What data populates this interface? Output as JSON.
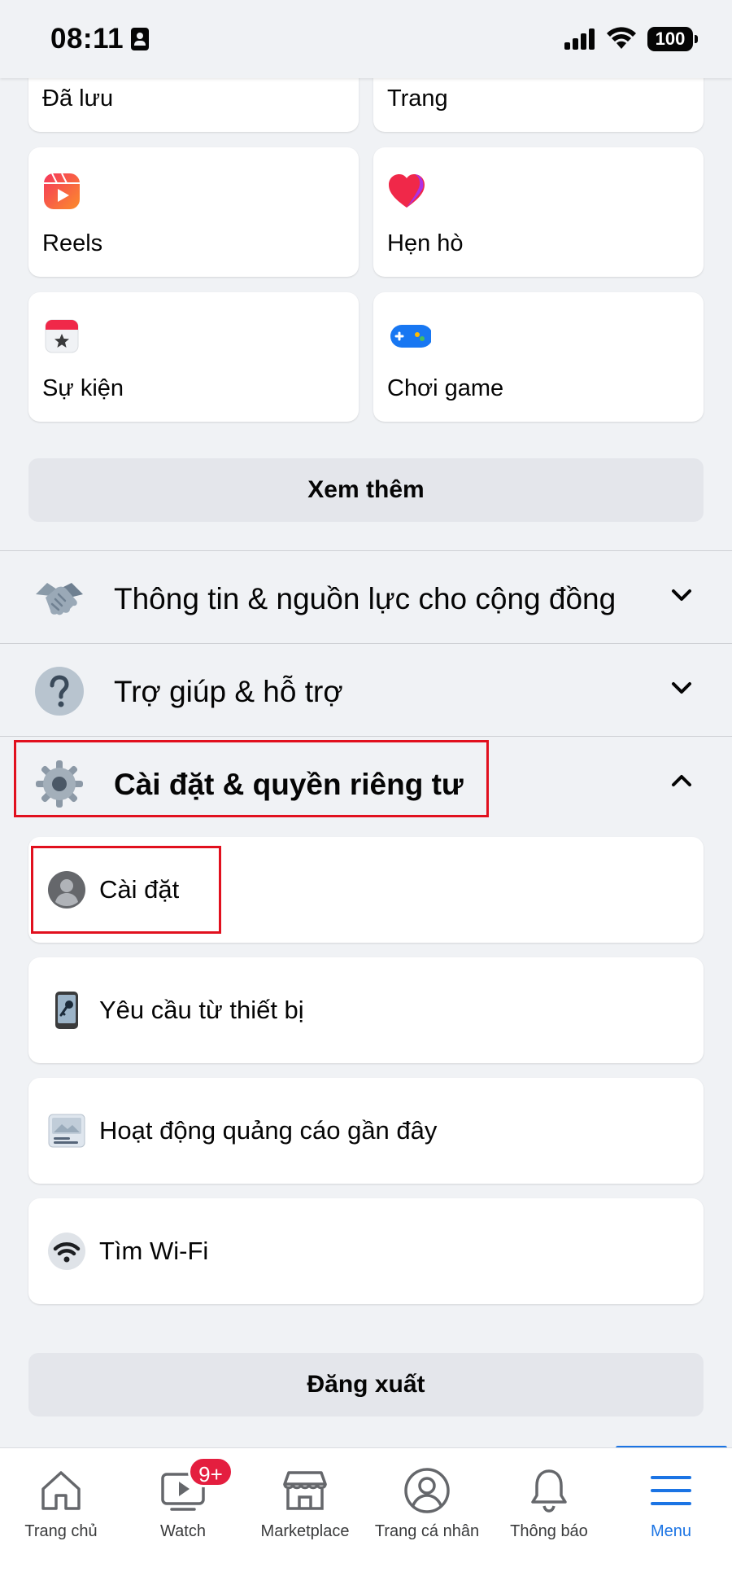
{
  "status_bar": {
    "time": "08:11",
    "battery": "100"
  },
  "shortcuts": {
    "saved": "Đã lưu",
    "pages": "Trang",
    "reels": "Reels",
    "dating": "Hẹn hò",
    "events": "Sự kiện",
    "gaming": "Chơi game"
  },
  "see_more": "Xem thêm",
  "sections": {
    "community": "Thông tin & nguồn lực cho cộng đồng",
    "help": "Trợ giúp & hỗ trợ",
    "settings_privacy": "Cài đặt & quyền riêng tư"
  },
  "settings_items": {
    "settings": "Cài đặt",
    "device_requests": "Yêu cầu từ thiết bị",
    "ad_activity": "Hoạt động quảng cáo gần đây",
    "find_wifi": "Tìm Wi-Fi"
  },
  "logout": "Đăng xuất",
  "bottom_nav": {
    "home": "Trang chủ",
    "watch": "Watch",
    "watch_badge": "9+",
    "marketplace": "Marketplace",
    "profile": "Trang cá nhân",
    "notifications": "Thông báo",
    "menu": "Menu"
  },
  "colors": {
    "accent": "#1b74e4",
    "annotation": "#e1101e",
    "badge": "#e41e3f"
  }
}
